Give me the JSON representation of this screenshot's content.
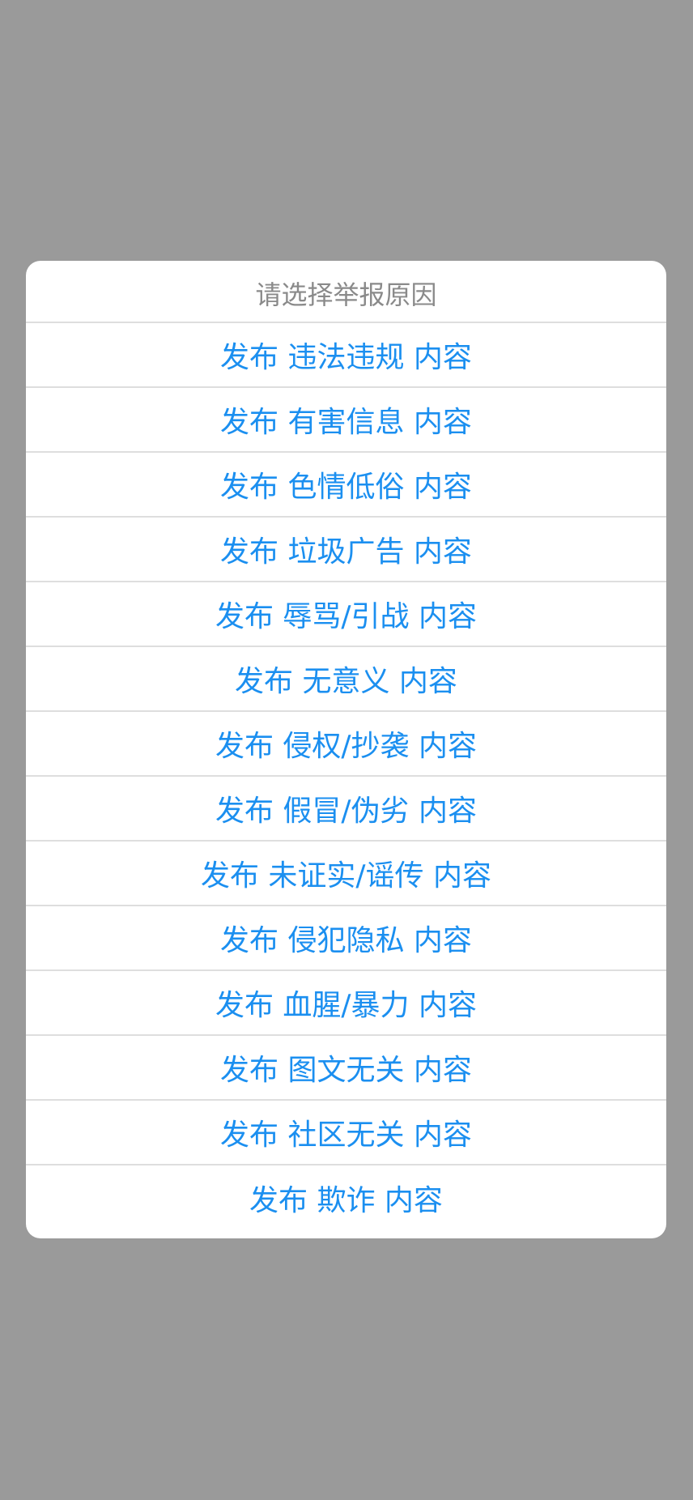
{
  "dialog": {
    "title": "请选择举报原因",
    "options": [
      "发布 违法违规 内容",
      "发布 有害信息 内容",
      "发布 色情低俗 内容",
      "发布 垃圾广告 内容",
      "发布 辱骂/引战 内容",
      "发布 无意义 内容",
      "发布 侵权/抄袭 内容",
      "发布 假冒/伪劣 内容",
      "发布 未证实/谣传 内容",
      "发布 侵犯隐私 内容",
      "发布 血腥/暴力 内容",
      "发布 图文无关 内容",
      "发布 社区无关 内容",
      "发布 欺诈 内容"
    ]
  },
  "colors": {
    "overlay": "#9a9a9a",
    "sheet": "#ffffff",
    "title_text": "#8a8a8a",
    "option_text": "#1b8ff0",
    "divider": "#dedede"
  }
}
